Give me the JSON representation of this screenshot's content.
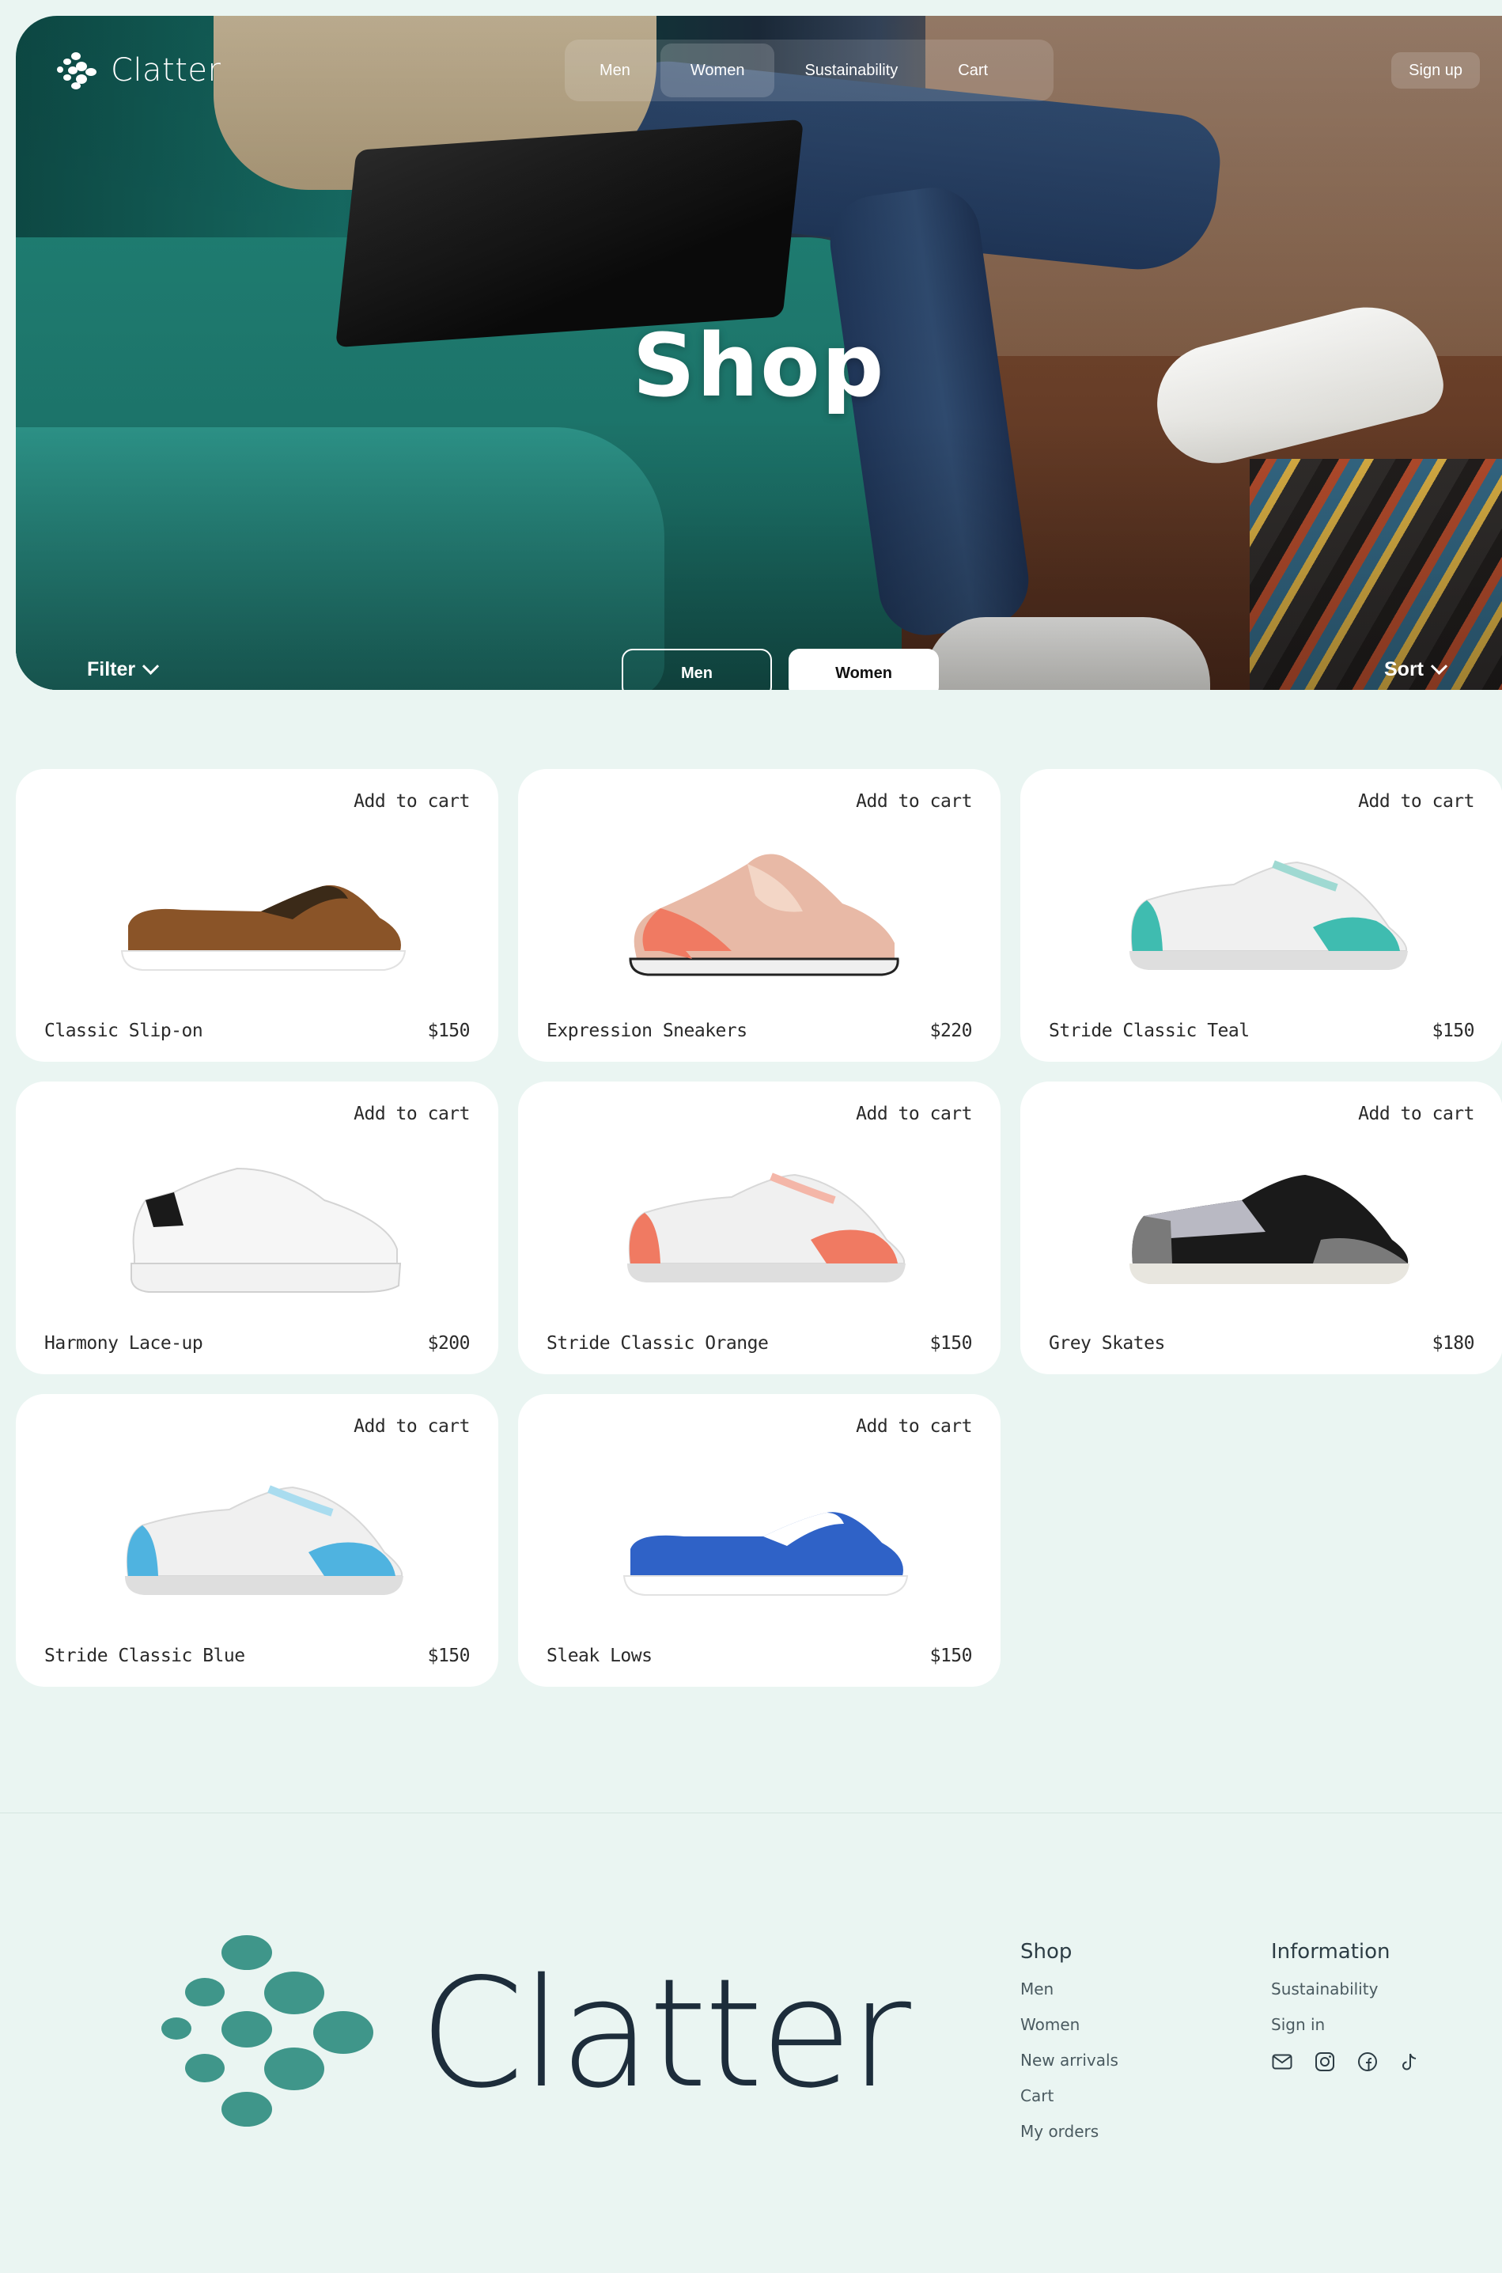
{
  "brand": {
    "name": "Clatter"
  },
  "nav": {
    "items": [
      {
        "label": "Men",
        "active": false
      },
      {
        "label": "Women",
        "active": true
      },
      {
        "label": "Sustainability",
        "active": false
      },
      {
        "label": "Cart",
        "active": false
      }
    ],
    "signup_label": "Sign up"
  },
  "hero": {
    "title": "Shop",
    "filter_label": "Filter",
    "sort_label": "Sort",
    "segments": [
      {
        "label": "Men",
        "selected": false
      },
      {
        "label": "Women",
        "selected": true
      }
    ]
  },
  "products": [
    {
      "name": "Classic Slip-on",
      "price": "$150",
      "add_label": "Add to cart",
      "colors": [
        "#8a5428",
        "#ffffff"
      ]
    },
    {
      "name": "Expression Sneakers",
      "price": "$220",
      "add_label": "Add to cart",
      "colors": [
        "#e8b9a6",
        "#f07a62"
      ]
    },
    {
      "name": "Stride Classic Teal",
      "price": "$150",
      "add_label": "Add to cart",
      "colors": [
        "#f0f0f0",
        "#3fbcb0"
      ]
    },
    {
      "name": "Harmony Lace-up",
      "price": "$200",
      "add_label": "Add to cart",
      "colors": [
        "#f6f6f6",
        "#1a1a1a"
      ]
    },
    {
      "name": "Stride Classic Orange",
      "price": "$150",
      "add_label": "Add to cart",
      "colors": [
        "#f0f0f0",
        "#f07a62"
      ]
    },
    {
      "name": "Grey Skates",
      "price": "$180",
      "add_label": "Add to cart",
      "colors": [
        "#1a1a1a",
        "#b9b9c3"
      ]
    },
    {
      "name": "Stride Classic Blue",
      "price": "$150",
      "add_label": "Add to cart",
      "colors": [
        "#f0f0f0",
        "#4fb3e0"
      ]
    },
    {
      "name": "Sleak Lows",
      "price": "$150",
      "add_label": "Add to cart",
      "colors": [
        "#2f62c7",
        "#ffffff"
      ]
    }
  ],
  "footer": {
    "brand": "Clatter",
    "columns": [
      {
        "title": "Shop",
        "links": [
          "Men",
          "Women",
          "New arrivals",
          "Cart",
          "My orders"
        ]
      },
      {
        "title": "Information",
        "links": [
          "Sustainability",
          "Sign in"
        ]
      }
    ],
    "social_icons": [
      "mail-icon",
      "instagram-icon",
      "facebook-icon",
      "tiktok-icon"
    ]
  },
  "colors": {
    "page_bg": "#eaf5f2",
    "brand_teal": "#3f968a",
    "brand_dark": "#1d2d3b"
  }
}
